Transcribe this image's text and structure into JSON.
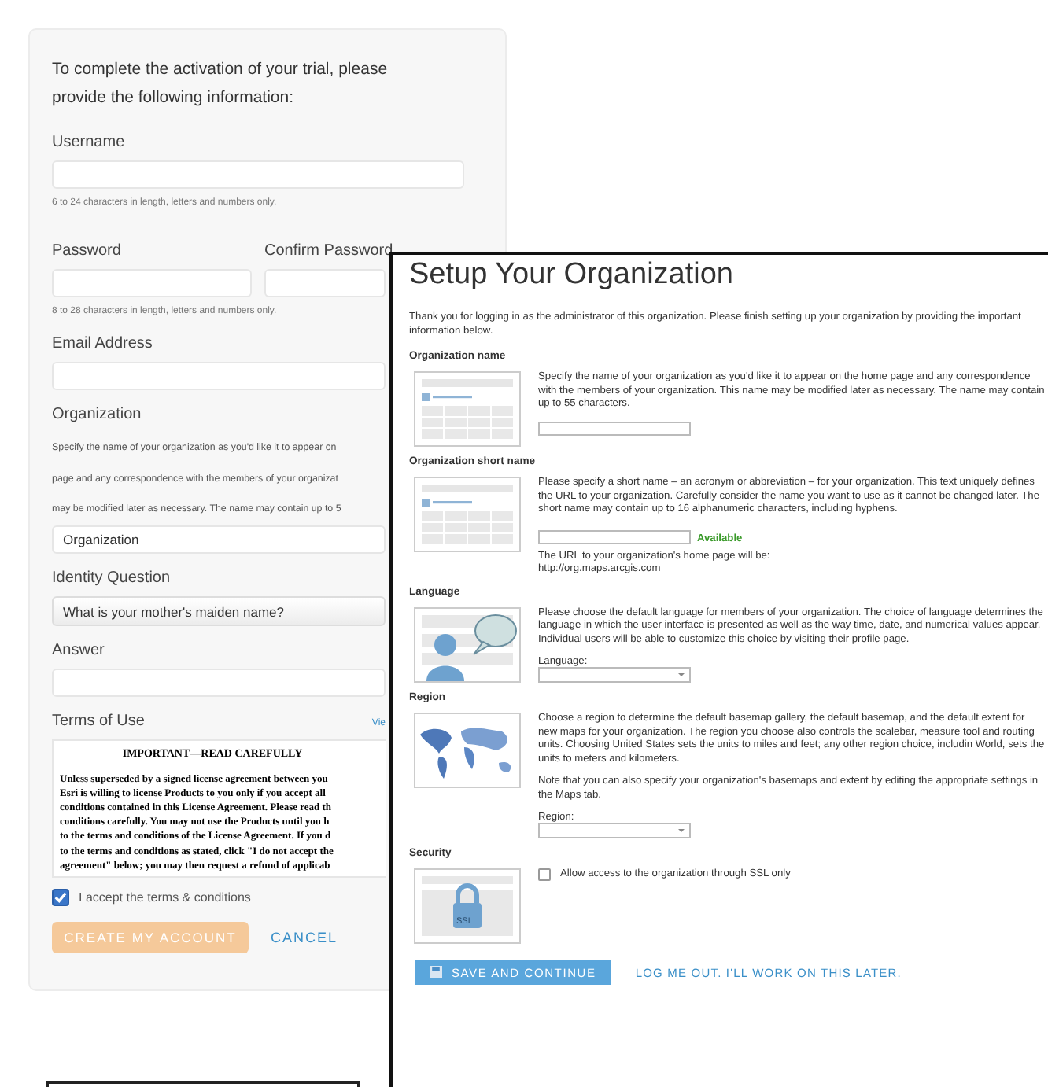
{
  "signup_form": {
    "intro": "To complete the activation of your trial, please provide the following information:",
    "fields": [
      {
        "kind": "text",
        "label": "Username",
        "hint": "6 to 24 characters in length, letters and numbers only."
      },
      {
        "kind": "pair",
        "labels": [
          "Password",
          "Confirm Password"
        ],
        "hint": "8 to 28 characters in length, letters and numbers only."
      },
      {
        "kind": "text",
        "label": "Email Address"
      },
      {
        "kind": "described",
        "label": "Organization",
        "description_lines": [
          "Specify the name of your organization as you'd like it to appear on",
          "page and any correspondence with the members of your organizat",
          "may be modified later as necessary. The name may contain up to 5"
        ],
        "placeholder": "Organization"
      },
      {
        "kind": "select",
        "label": "Identity Question",
        "value": "What is your mother's maiden name?"
      },
      {
        "kind": "text",
        "label": "Answer"
      }
    ],
    "terms": {
      "label": "Terms of Use",
      "link": "Vie",
      "heading": "IMPORTANT—READ CAREFULLY",
      "lines": [
        "Unless superseded by a signed license agreement between you",
        "Esri is willing to license Products to you only if you accept all",
        "conditions contained in this License Agreement. Please read th",
        "conditions carefully. You may not use the Products until you h",
        "to the terms and conditions of the License Agreement. If you d",
        "to the terms and conditions as stated, click \"I do not accept the",
        "agreement\" below; you may then request a refund of applicab"
      ],
      "accept": {
        "label": "I accept the terms & conditions",
        "checked": true
      }
    },
    "create_button": "CREATE MY ACCOUNT",
    "cancel_link": "CANCEL"
  },
  "setup": {
    "title": "Setup Your Organization",
    "intro": "Thank you for logging in as the administrator of this organization. Please finish setting up your organization by providing the important information below.",
    "sections": [
      {
        "kind": "name",
        "heading": "Organization name",
        "paragraphs": [
          "Specify the name of your organization as you'd like it to appear on the home page and any correspondence with the members of your organization. This name may be modified later as necessary. The name may contain up to 55 characters."
        ]
      },
      {
        "kind": "shortname",
        "heading": "Organization short name",
        "paragraphs": [
          "Please specify a short name – an acronym or abbreviation – for your organization. This text uniquely defines the URL to your organization. Carefully consider the name you want to use as it cannot be changed later. The short name may contain up to 16 alphanumeric characters, including hyphens."
        ],
        "status": "Available",
        "url_lines": [
          "The URL to your organization's home page will be:",
          "http://org.maps.arcgis.com"
        ]
      },
      {
        "kind": "language",
        "heading": "Language",
        "paragraphs": [
          "Please choose the default language for members of your organization. The choice of language determines the language in which the user interface is presented as well as the way time, date, and numerical values appear. Individual users will be able to customize this choice by visiting their profile page."
        ],
        "field_label": "Language:"
      },
      {
        "kind": "region",
        "heading": "Region",
        "paragraphs": [
          "Choose a region to determine the default basemap gallery, the default basemap, and the default extent for new maps for your organization. The region you choose also controls the scalebar, measure tool and routing units. Choosing United States sets the units to miles and feet; any other region choice, includin World, sets the units to meters and kilometers.",
          "Note that you can also specify your organization's basemaps and extent by editing the appropriate settings in the Maps tab."
        ],
        "field_label": "Region:"
      },
      {
        "kind": "security",
        "lock_label": "SSL",
        "heading": "Security",
        "checkbox": {
          "label": "Allow access to the organization through SSL only",
          "checked": false
        }
      }
    ],
    "save_button": "SAVE AND CONTINUE",
    "logout_link": "LOG ME OUT. I'LL WORK ON THIS LATER."
  }
}
